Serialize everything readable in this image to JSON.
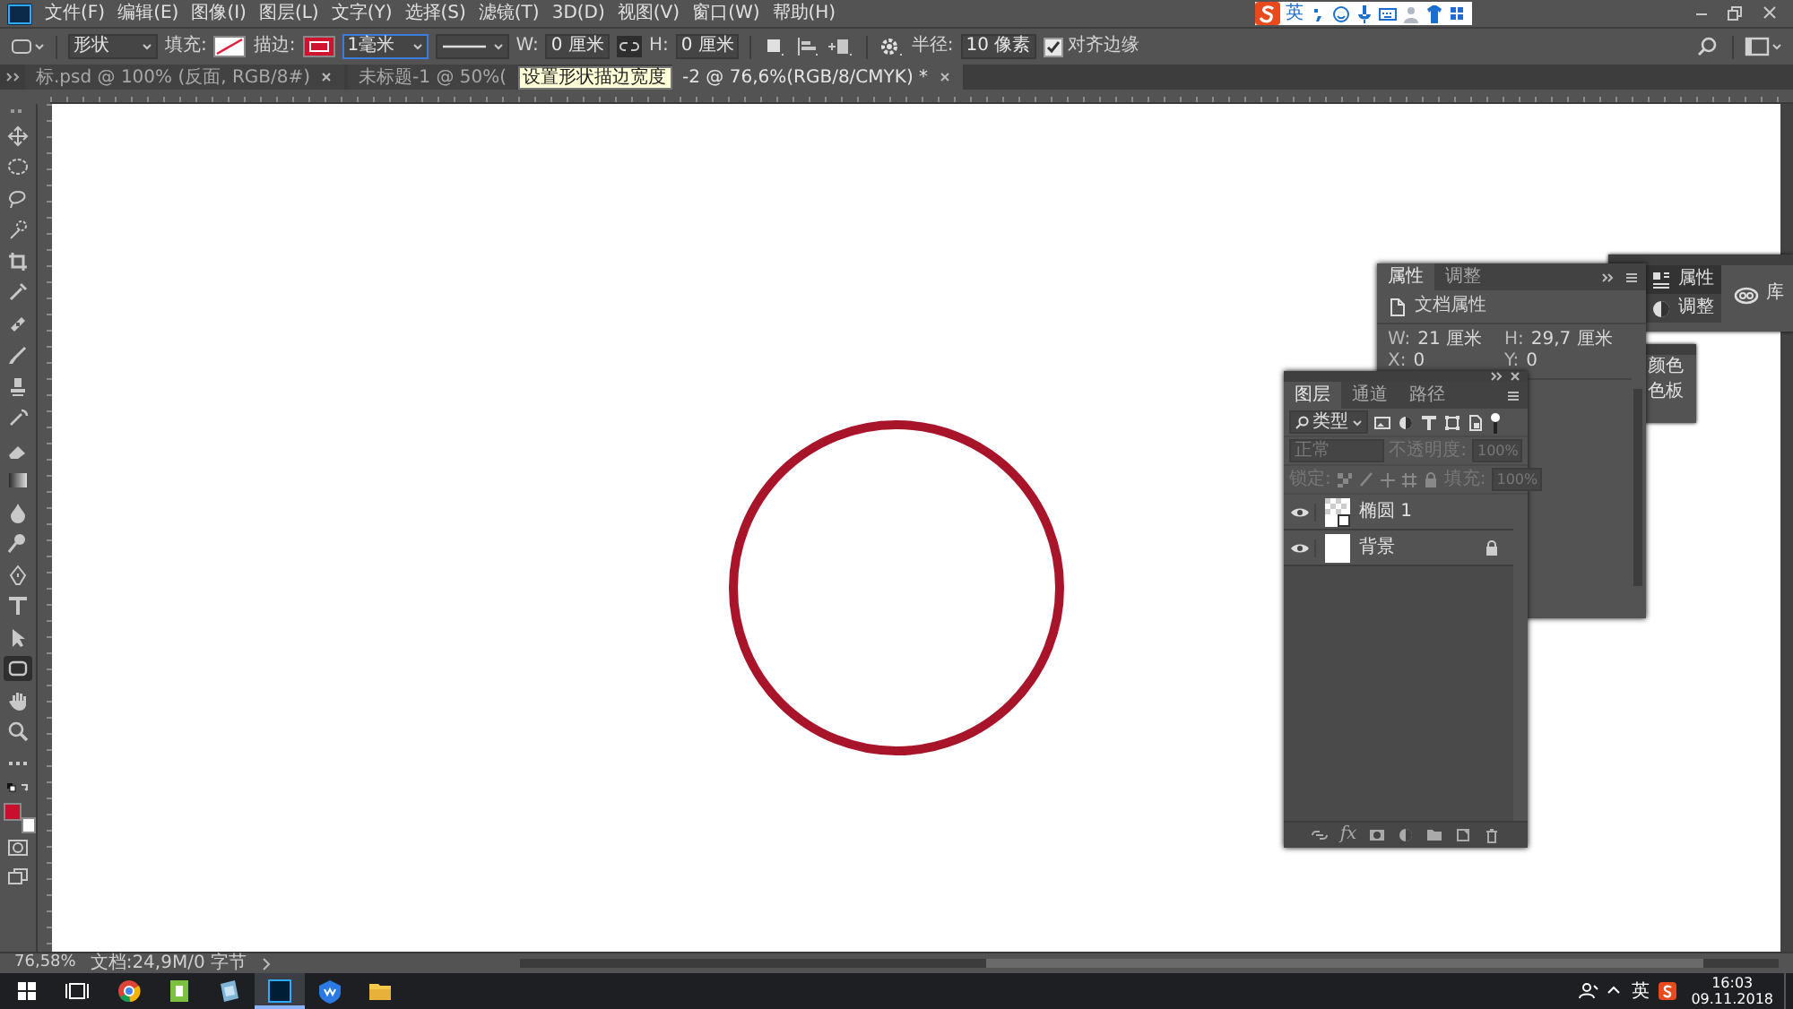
{
  "menu": [
    "文件(F)",
    "编辑(E)",
    "图像(I)",
    "图层(L)",
    "文字(Y)",
    "选择(S)",
    "滤镜(T)",
    "3D(D)",
    "视图(V)",
    "窗口(W)",
    "帮助(H)"
  ],
  "ime_bar": {
    "label": "英"
  },
  "options_bar": {
    "mode": "形状",
    "fill_label": "填充:",
    "stroke_label": "描边:",
    "stroke_width": "1毫米",
    "w_label": "W:",
    "w_value": "0 厘米",
    "h_label": "H:",
    "h_value": "0 厘米",
    "radius_label": "半径:",
    "radius_value": "10 像素",
    "align_edges": {
      "label": "对齐边缘",
      "checked": true
    }
  },
  "doc_tabs": [
    {
      "label": "标.psd @ 100% (反面, RGB/8#)",
      "selected": false
    },
    {
      "label": "未标题-1 @ 50%(",
      "selected": false
    },
    {
      "label": "-2 @ 76,6%(RGB/8/CMYK) *",
      "selected": true
    }
  ],
  "tooltip": "设置形状描边宽度",
  "tools": [
    {
      "kind": "move",
      "selected": false
    },
    {
      "kind": "marquee",
      "selected": false
    },
    {
      "kind": "lasso",
      "selected": false
    },
    {
      "kind": "quick-select",
      "selected": false
    },
    {
      "kind": "crop",
      "selected": false
    },
    {
      "kind": "eyedropper",
      "selected": false
    },
    {
      "kind": "healing",
      "selected": false
    },
    {
      "kind": "brush",
      "selected": false
    },
    {
      "kind": "stamp",
      "selected": false
    },
    {
      "kind": "history-brush",
      "selected": false
    },
    {
      "kind": "eraser",
      "selected": false
    },
    {
      "kind": "gradient",
      "selected": false
    },
    {
      "kind": "blur",
      "selected": false
    },
    {
      "kind": "dodge",
      "selected": false
    },
    {
      "kind": "pen",
      "selected": false
    },
    {
      "kind": "type",
      "selected": false
    },
    {
      "kind": "path-select",
      "selected": false
    },
    {
      "kind": "rectangle",
      "selected": true
    },
    {
      "kind": "hand",
      "selected": false
    },
    {
      "kind": "zoom",
      "selected": false
    },
    {
      "kind": "more",
      "selected": false
    }
  ],
  "color_swatches": [
    {
      "kind": "foreground",
      "color": "#c8102e"
    },
    {
      "kind": "background",
      "color": "#ffffff"
    }
  ],
  "canvas": {
    "shape": {
      "kind": "circle",
      "color": "#a8142a"
    }
  },
  "side_dock": {
    "tabs": [
      {
        "label": "属性",
        "selected": true
      },
      {
        "label": "调整",
        "selected": false
      }
    ],
    "library": "库"
  },
  "color_dock": {
    "items": [
      "颜色",
      "色板"
    ]
  },
  "properties_panel": {
    "tabs": [
      {
        "label": "属性",
        "selected": true
      },
      {
        "label": "调整",
        "selected": false
      }
    ],
    "title": "文档属性",
    "fields": [
      {
        "label": "W:",
        "value": "21 厘米"
      },
      {
        "label": "H:",
        "value": "29,7 厘米"
      },
      {
        "label": "X:",
        "value": "0"
      },
      {
        "label": "Y:",
        "value": "0"
      }
    ]
  },
  "layers_panel": {
    "tabs": [
      {
        "label": "图层",
        "selected": true
      },
      {
        "label": "通道",
        "selected": false
      },
      {
        "label": "路径",
        "selected": false
      }
    ],
    "filter": "类型",
    "blend_mode": "正常",
    "opacity_label": "不透明度:",
    "opacity": "100%",
    "lock_label": "锁定:",
    "fill_label": "填充:",
    "fill": "100%",
    "layers": [
      {
        "name": "椭圆 1",
        "kind": "shape",
        "visible": true,
        "locked": false
      },
      {
        "name": "背景",
        "kind": "background",
        "visible": true,
        "locked": true
      }
    ],
    "fx": "fx"
  },
  "status_bar": {
    "zoom": "76,58%",
    "doc_info": "文档:24,9M/0 字节"
  },
  "taskbar": {
    "apps": [
      {
        "kind": "chrome",
        "selected": false
      },
      {
        "kind": "green-app",
        "selected": false
      },
      {
        "kind": "blue-app",
        "selected": false
      },
      {
        "kind": "photoshop",
        "selected": true
      },
      {
        "kind": "wps",
        "selected": false
      },
      {
        "kind": "folder",
        "selected": false
      }
    ],
    "language": "英",
    "time": "16:03",
    "date": "09.11.2018"
  }
}
